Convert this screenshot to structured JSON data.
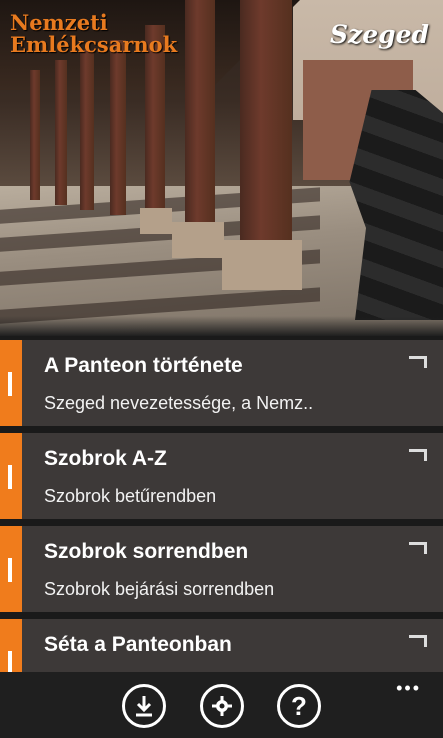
{
  "header": {
    "logo_line1": "Nemzeti",
    "logo_line2": "Emlékcsarnok",
    "city": "Szeged"
  },
  "menu": {
    "items": [
      {
        "title": "A Panteon története",
        "subtitle": "Szeged nevezetessége, a Nemz.."
      },
      {
        "title": "Szobrok A-Z",
        "subtitle": "Szobrok betűrendben"
      },
      {
        "title": "Szobrok sorrendben",
        "subtitle": "Szobrok bejárási sorrendben"
      },
      {
        "title": "Séta a Panteonban",
        "subtitle": ""
      }
    ]
  },
  "appbar": {
    "help_glyph": "?",
    "more_glyph": "•••"
  },
  "colors": {
    "accent": "#f07c1c",
    "tile_bg": "#3d3938",
    "logo": "#e87a1f"
  }
}
